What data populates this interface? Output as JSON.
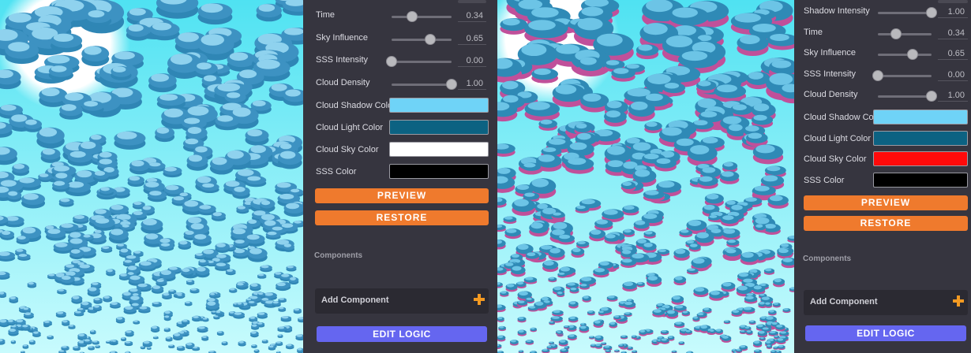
{
  "left_panel": {
    "sliders": [
      {
        "label": "Time",
        "value": "0.34",
        "fraction": 0.34
      },
      {
        "label": "Sky Influence",
        "value": "0.65",
        "fraction": 0.65
      },
      {
        "label": "SSS Intensity",
        "value": "0.00",
        "fraction": 0.0
      },
      {
        "label": "Cloud Density",
        "value": "1.00",
        "fraction": 1.0
      }
    ],
    "colors": [
      {
        "label": "Cloud Shadow Color",
        "color": "#6fd3f7"
      },
      {
        "label": "Cloud Light Color",
        "color": "#0c6282"
      },
      {
        "label": "Cloud Sky Color",
        "color": "#ffffff"
      },
      {
        "label": "SSS Color",
        "color": "#000000"
      }
    ],
    "preview_label": "PREVIEW",
    "restore_label": "RESTORE",
    "components_title": "Components",
    "add_component_label": "Add Component",
    "edit_logic_label": "EDIT LOGIC"
  },
  "right_panel": {
    "sliders": [
      {
        "label": "Shadow Intensity",
        "value": "1.00",
        "fraction": 1.0
      },
      {
        "label": "Time",
        "value": "0.34",
        "fraction": 0.34
      },
      {
        "label": "Sky Influence",
        "value": "0.65",
        "fraction": 0.65
      },
      {
        "label": "SSS Intensity",
        "value": "0.00",
        "fraction": 0.0
      },
      {
        "label": "Cloud Density",
        "value": "1.00",
        "fraction": 1.0
      }
    ],
    "colors": [
      {
        "label": "Cloud Shadow Color",
        "color": "#6fd3f7"
      },
      {
        "label": "Cloud Light Color",
        "color": "#0c6282"
      },
      {
        "label": "Cloud Sky Color",
        "color": "#ff0a0a"
      },
      {
        "label": "SSS Color",
        "color": "#000000"
      }
    ],
    "preview_label": "PREVIEW",
    "restore_label": "RESTORE",
    "components_title": "Components",
    "add_component_label": "Add Component",
    "edit_logic_label": "EDIT LOGIC"
  },
  "theme": {
    "accent_orange": "#ef7a2d",
    "accent_purple": "#6566f0",
    "panel_bg": "#36353f",
    "sky_cyan": "#5de8f2"
  }
}
